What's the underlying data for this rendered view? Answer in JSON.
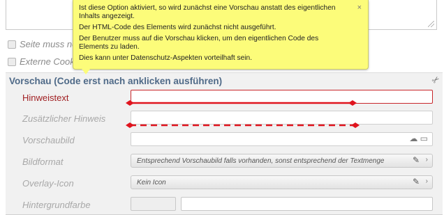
{
  "options": {
    "seite_label": "Seite muss neu",
    "cookies_label": "Externe Cookie"
  },
  "tooltip": {
    "close": "×",
    "lines": [
      "Ist diese Option aktiviert, so wird zunächst eine Vorschau anstatt des eigentlichen Inhalts angezeigt.",
      "Der HTML-Code des Elements wird zunächst nicht ausgeführt.",
      "Der Benutzer muss auf die Vorschau klicken, um den eigentlichen Code des Elements zu laden.",
      "Dies kann unter Datenschutz-Aspekten vorteilhaft sein."
    ]
  },
  "section": {
    "title": "Vorschau (Code erst nach anklicken ausführen)"
  },
  "fields": {
    "hinweistext": "Hinweistext",
    "zusatz": "Zusätzlicher Hinweis",
    "vorschaubild": "Vorschaubild",
    "bildformat": "Bildformat",
    "bildformat_value": "Entsprechend Vorschaubild falls vorhanden, sonst entsprechend der Textmenge",
    "overlay": "Overlay-Icon",
    "overlay_value": "Kein Icon",
    "hintergrund": "Hintergrundfarbe"
  },
  "colors": {
    "accent_red": "#e0141e",
    "title_blue": "#4f6a88",
    "tooltip_yellow": "#fcfc7a"
  },
  "icons": {
    "scissors": "scissors-icon",
    "cloud": "cloud-icon",
    "folder": "folder-icon",
    "pencil": "pencil-icon",
    "arrow": "chevron-right-icon"
  }
}
